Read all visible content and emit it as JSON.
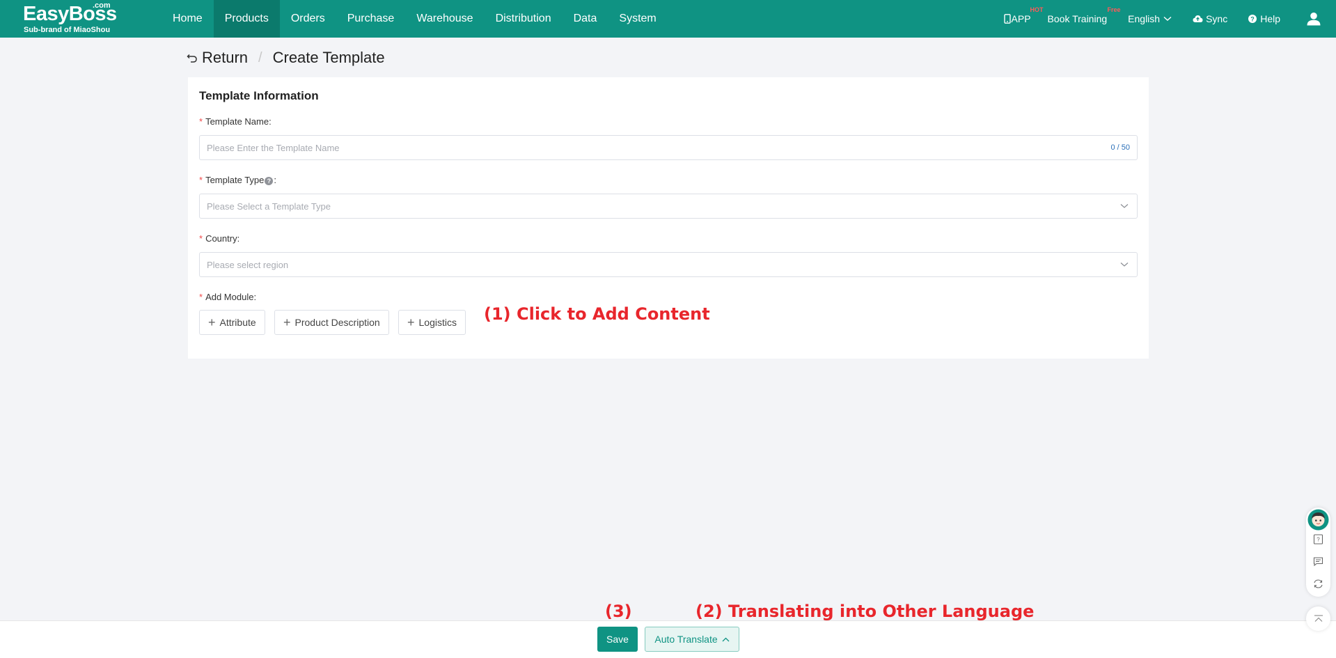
{
  "brand": {
    "name": "EasyBoss",
    "suffix": ".com",
    "subtitle": "Sub-brand of MiaoShou"
  },
  "nav": {
    "items": [
      {
        "label": "Home",
        "active": false
      },
      {
        "label": "Products",
        "active": true
      },
      {
        "label": "Orders",
        "active": false
      },
      {
        "label": "Purchase",
        "active": false
      },
      {
        "label": "Warehouse",
        "active": false
      },
      {
        "label": "Distribution",
        "active": false
      },
      {
        "label": "Data",
        "active": false
      },
      {
        "label": "System",
        "active": false
      }
    ],
    "app_label": "APP",
    "app_badge": "HOT",
    "training_label": "Book Training",
    "training_badge": "Free",
    "language": "English",
    "sync_label": "Sync",
    "help_label": "Help"
  },
  "breadcrumb": {
    "return_label": "Return",
    "current": "Create Template"
  },
  "form": {
    "title": "Template Information",
    "name_label": "Template Name:",
    "name_placeholder": "Please Enter the Template Name",
    "name_counter": "0 / 50",
    "type_label_a": "Template Type",
    "type_label_b": ":",
    "type_placeholder": "Please Select a Template Type",
    "country_label": "Country:",
    "country_placeholder": "Please select region",
    "module_label": "Add Module:",
    "modules": [
      "Attribute",
      "Product Description",
      "Logistics"
    ],
    "required_mark": "*"
  },
  "annotations": {
    "step1": "(1) Click to Add Content",
    "step2": "(2) Translating into Other Language",
    "step3": "(3)"
  },
  "footer": {
    "save_label": "Save",
    "translate_label": "Auto Translate"
  },
  "colors": {
    "brand": "#0f9383",
    "annotation": "#e8262c",
    "required": "#f04a4a"
  }
}
